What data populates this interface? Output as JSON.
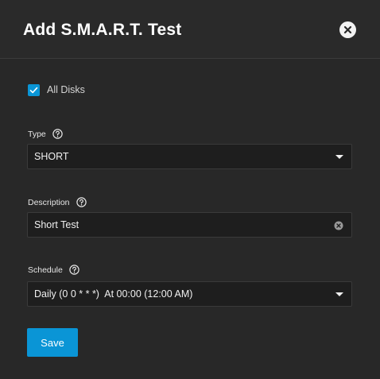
{
  "dialog": {
    "title": "Add S.M.A.R.T. Test"
  },
  "all_disks": {
    "label": "All Disks",
    "checked": true
  },
  "type": {
    "label": "Type",
    "value": "SHORT"
  },
  "description": {
    "label": "Description",
    "value": "Short Test"
  },
  "schedule": {
    "label": "Schedule",
    "value": "Daily (0 0 * * *)  At 00:00 (12:00 AM)"
  },
  "save_label": "Save",
  "colors": {
    "accent": "#0a95d6",
    "background": "#282828",
    "field_background": "#1e1e1e"
  },
  "icons": {
    "close": "close-circle-icon",
    "checkbox": "checkmark-icon",
    "help": "help-circle-icon",
    "dropdown": "caret-down-icon",
    "clear": "clear-circle-icon"
  }
}
